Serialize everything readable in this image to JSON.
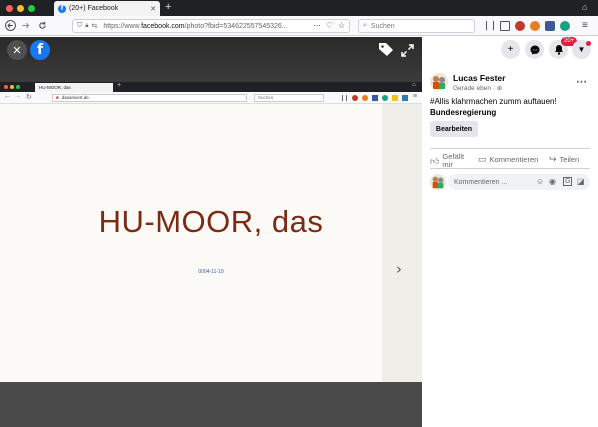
{
  "browser": {
    "tab_title": "(20+) Facebook",
    "url_prefix": "https://www.",
    "url_domain": "facebook.com",
    "url_rest": "/photo?fbid=534622557545326...",
    "search_placeholder": "Suchen",
    "new_tab": "+"
  },
  "viewer": {
    "close_icon": "✕",
    "next_icon": "›"
  },
  "inner_screenshot": {
    "tab_title": "HU-MOOR, das",
    "url": "dasanivert.de",
    "search_placeholder": "Suchen",
    "heading": "HU-MOOR, das",
    "date": "0004-11-10"
  },
  "panel": {
    "notifications_badge": "20+",
    "user_name": "Lucas Fester",
    "post_time": "Gerade eben",
    "post_line1": "#Allis klahrmachen zumm auftauen!",
    "post_line2": "Bundesregierung",
    "edit_label": "Bearbeiten",
    "like_label_1": "Gefällt",
    "like_label_2": "mir",
    "comment_label": "Kommentieren",
    "share_label": "Teilen",
    "comment_placeholder": "Kommentieren ..."
  },
  "colors": {
    "facebook_blue": "#1877f2",
    "heading_color": "#7c2a14",
    "badge_red": "#e41e3f"
  }
}
